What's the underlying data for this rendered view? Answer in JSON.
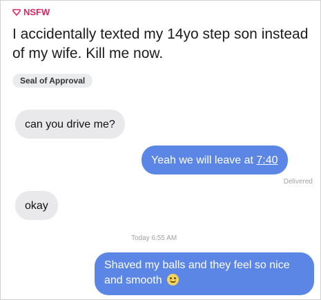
{
  "post": {
    "nsfw_label": "NSFW",
    "title": "I accidentally texted my 14yo step son instead of my wife. Kill me now.",
    "flair": "Seal of Approval"
  },
  "conversation": {
    "msg1": "can you drive me?",
    "msg2_prefix": "Yeah we will leave at ",
    "msg2_time": "7:40",
    "delivered": "Delivered",
    "msg3": "okay",
    "timestamp": "Today 6:55 AM",
    "msg4": "Shaved my balls and they feel so nice and smooth"
  },
  "colors": {
    "nsfw": "#e0245e",
    "outgoing_bubble": "#5b86e5",
    "incoming_bubble": "#e9e9eb"
  },
  "icons": [
    "nsfw-icon",
    "grinning-emoji-icon"
  ]
}
